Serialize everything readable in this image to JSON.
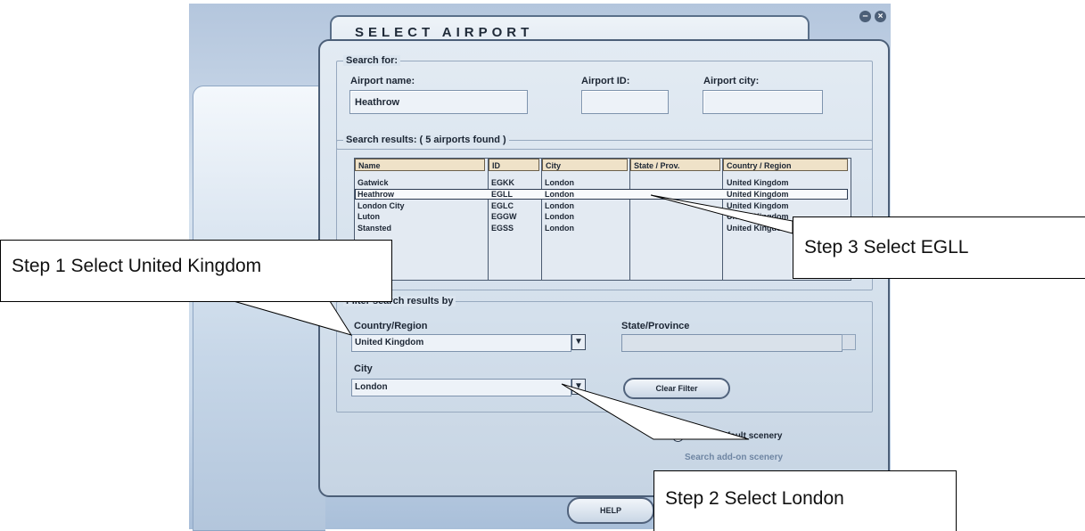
{
  "window": {
    "title": "SELECT AIRPORT",
    "controls": {
      "minimize_icon": "minus-circle-icon",
      "close_icon": "x-circle-icon"
    }
  },
  "search": {
    "legend": "Search for:",
    "airport_name_label": "Airport name:",
    "airport_name_value": "Heathrow",
    "airport_id_label": "Airport ID:",
    "airport_id_value": "",
    "airport_city_label": "Airport city:",
    "airport_city_value": ""
  },
  "results": {
    "legend": "Search results: ( 5 airports found )",
    "columns": [
      "Name",
      "ID",
      "City",
      "State / Prov.",
      "Country / Region"
    ],
    "rows": [
      [
        "Gatwick",
        "EGKK",
        "London",
        "",
        "United Kingdom"
      ],
      [
        "Heathrow",
        "EGLL",
        "London",
        "",
        "United Kingdom"
      ],
      [
        "London City",
        "EGLC",
        "London",
        "",
        "United Kingdom"
      ],
      [
        "Luton",
        "EGGW",
        "London",
        "",
        "United Kingdom"
      ],
      [
        "Stansted",
        "EGSS",
        "London",
        "",
        "United Kingdom"
      ]
    ],
    "selected_row": "Heathrow"
  },
  "filter": {
    "legend": "Filter search results by",
    "country_label": "Country/Region",
    "country_value": "United Kingdom",
    "state_label": "State/Province",
    "state_value": "",
    "city_label": "City",
    "city_value": "London",
    "clear_button": "Clear Filter"
  },
  "options": {
    "search_default": "Search default scenery",
    "search_addon": "Search add-on scenery"
  },
  "footer": {
    "help_button": "HELP"
  },
  "callouts": {
    "step1": "Step 1 Select United Kingdom",
    "step2": "Step 2 Select London",
    "step3": "Step 3 Select EGLL"
  }
}
